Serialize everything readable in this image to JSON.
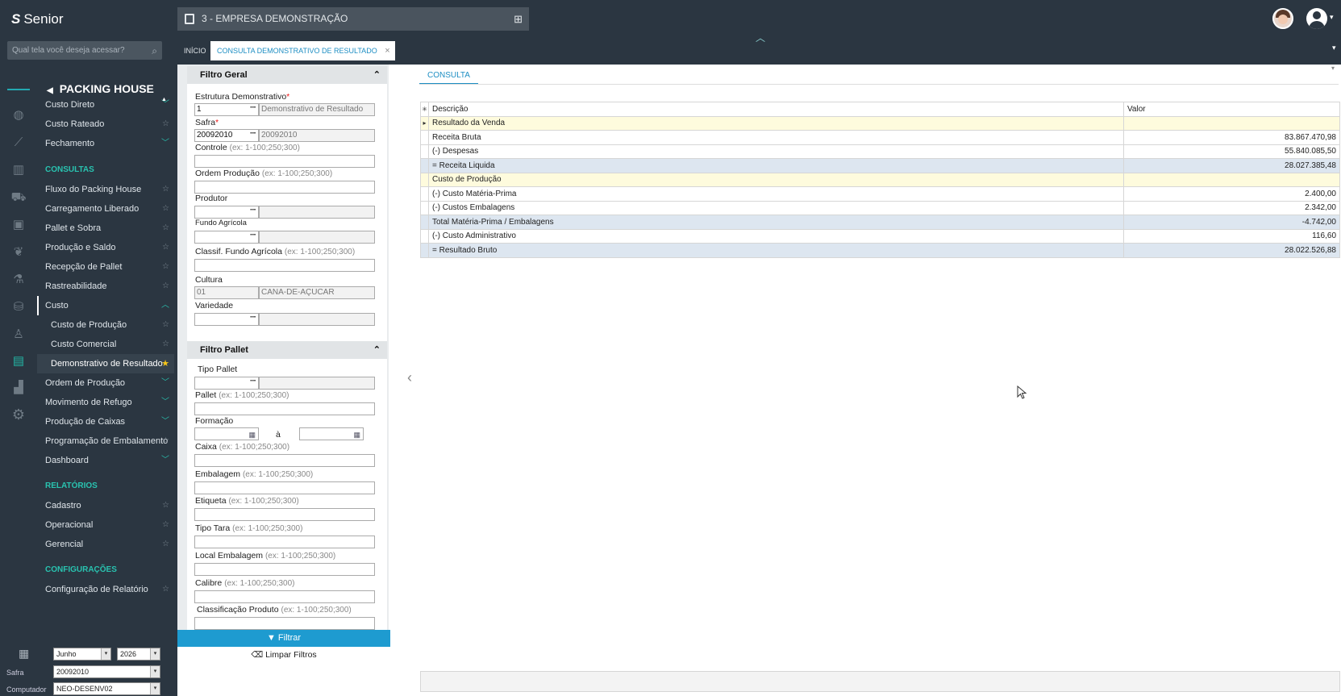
{
  "app": {
    "brand": "Senior",
    "company": "3 - EMPRESA DEMONSTRAÇÃO"
  },
  "search": {
    "placeholder": "Qual tela você deseja acessar?"
  },
  "tabs": [
    {
      "label": "INÍCIO"
    },
    {
      "label": "CONSULTA DEMONSTRATIVO DE RESULTADO",
      "close": "×"
    }
  ],
  "menu": {
    "title": "PACKING HOUSE",
    "items": [
      {
        "label": "Custo Direto"
      },
      {
        "label": "Custo Rateado"
      },
      {
        "label": "Fechamento"
      },
      {
        "label": "CONSULTAS"
      },
      {
        "label": "Fluxo do Packing House"
      },
      {
        "label": "Carregamento Liberado"
      },
      {
        "label": "Pallet e Sobra"
      },
      {
        "label": "Produção e Saldo"
      },
      {
        "label": "Recepção de Pallet"
      },
      {
        "label": "Rastreabilidade"
      },
      {
        "label": "Custo"
      },
      {
        "label": "Custo de Produção"
      },
      {
        "label": "Custo Comercial"
      },
      {
        "label": "Demonstrativo de Resultado"
      },
      {
        "label": "Ordem de Produção"
      },
      {
        "label": "Movimento de Refugo"
      },
      {
        "label": "Produção de Caixas"
      },
      {
        "label": "Programação de Embalamento"
      },
      {
        "label": "Dashboard"
      },
      {
        "label": "RELATÓRIOS"
      },
      {
        "label": "Cadastro"
      },
      {
        "label": "Operacional"
      },
      {
        "label": "Gerencial"
      },
      {
        "label": "CONFIGURAÇÕES"
      },
      {
        "label": "Configuração de Relatório"
      }
    ]
  },
  "bottom": {
    "month": "Junho",
    "year": "2026",
    "safra_label": "Safra",
    "safra": "20092010",
    "computador_label": "Computador",
    "computador": "NEO-DESENV02"
  },
  "filtro_geral": {
    "title": "Filtro Geral",
    "estrutura_label": "Estrutura Demonstrativo",
    "estrutura_code": "1",
    "estrutura_desc": "Demonstrativo de Resultado",
    "safra_label": "Safra",
    "safra_code": "20092010",
    "safra_desc": "20092010",
    "controle_label": "Controle",
    "ordem_label": "Ordem Produção",
    "produtor_label": "Produtor",
    "fundo_label": "Fundo Agrícola",
    "classif_label": "Classif. Fundo Agrícola",
    "cultura_label": "Cultura",
    "cultura_code": "01",
    "cultura_desc": "CANA-DE-AÇUCAR",
    "variedade_label": "Variedade",
    "hint": "(ex: 1-100;250;300)"
  },
  "filtro_pallet": {
    "title": "Filtro Pallet",
    "tipo_pallet_label": "Tipo Pallet",
    "pallet_label": "Pallet",
    "formacao_label": "Formação",
    "ate": "à",
    "caixa_label": "Caixa",
    "embalagem_label": "Embalagem",
    "etiqueta_label": "Etiqueta",
    "tipo_tara_label": "Tipo Tara",
    "local_emb_label": "Local Embalagem",
    "calibre_label": "Calibre",
    "classif_prod_label": "Classificação Produto"
  },
  "buttons": {
    "filtrar": "Filtrar",
    "limpar": "Limpar Filtros"
  },
  "consulta": {
    "tab": "CONSULTA",
    "headers": {
      "descricao": "Descrição",
      "valor": "Valor"
    },
    "rows": [
      {
        "descricao": "Resultado da Venda",
        "valor": ""
      },
      {
        "descricao": "Receita Bruta",
        "valor": "83.867.470,98"
      },
      {
        "descricao": "(-) Despesas",
        "valor": "55.840.085,50"
      },
      {
        "descricao": "= Receita Liquida",
        "valor": "28.027.385,48"
      },
      {
        "descricao": "Custo de Produção",
        "valor": ""
      },
      {
        "descricao": "(-) Custo Matéria-Prima",
        "valor": "2.400,00"
      },
      {
        "descricao": "(-) Custos Embalagens",
        "valor": "2.342,00"
      },
      {
        "descricao": "Total Matéria-Prima / Embalagens",
        "valor": "-4.742,00"
      },
      {
        "descricao": "(-) Custo Administrativo",
        "valor": "116,60"
      },
      {
        "descricao": "= Resultado Bruto",
        "valor": "28.022.526,88"
      }
    ]
  },
  "colors": {
    "topbar": "#2b3641",
    "accent": "#1d8ec3",
    "teal": "#29c3b0",
    "star": "#f5c518",
    "row_yellow": "#fefbdd",
    "row_blue": "#dde6f0"
  }
}
